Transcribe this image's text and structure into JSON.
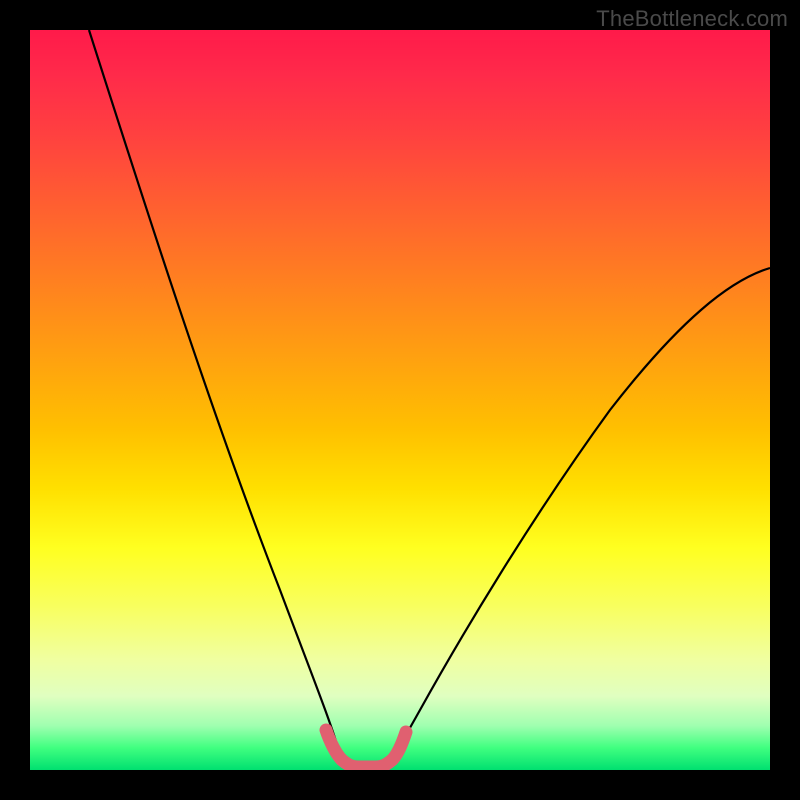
{
  "watermark": "TheBottleneck.com",
  "chart_data": {
    "type": "line",
    "title": "",
    "xlabel": "",
    "ylabel": "",
    "xlim": [
      0,
      100
    ],
    "ylim": [
      0,
      100
    ],
    "series": [
      {
        "name": "left-curve",
        "x": [
          8,
          12,
          16,
          20,
          24,
          28,
          32,
          35,
          37,
          39,
          40,
          41,
          42
        ],
        "y": [
          100,
          85,
          70,
          56,
          43,
          31,
          20,
          12,
          7,
          4,
          2,
          1,
          0
        ]
      },
      {
        "name": "right-curve",
        "x": [
          48,
          50,
          52,
          56,
          60,
          66,
          74,
          82,
          90,
          100
        ],
        "y": [
          0,
          1,
          3,
          7,
          12,
          20,
          32,
          44,
          55,
          68
        ]
      },
      {
        "name": "trough-marker",
        "x": [
          40,
          41,
          42,
          43,
          44,
          45,
          46,
          47,
          48,
          49,
          50
        ],
        "y": [
          4,
          2,
          1,
          0.5,
          0.4,
          0.4,
          0.4,
          0.5,
          1,
          2,
          4
        ],
        "style": "thick-salmon"
      }
    ],
    "gradient_stops": [
      {
        "pos": 0,
        "color": "#ff1a4a"
      },
      {
        "pos": 50,
        "color": "#ffc000"
      },
      {
        "pos": 80,
        "color": "#f8ff60"
      },
      {
        "pos": 100,
        "color": "#00e070"
      }
    ]
  }
}
